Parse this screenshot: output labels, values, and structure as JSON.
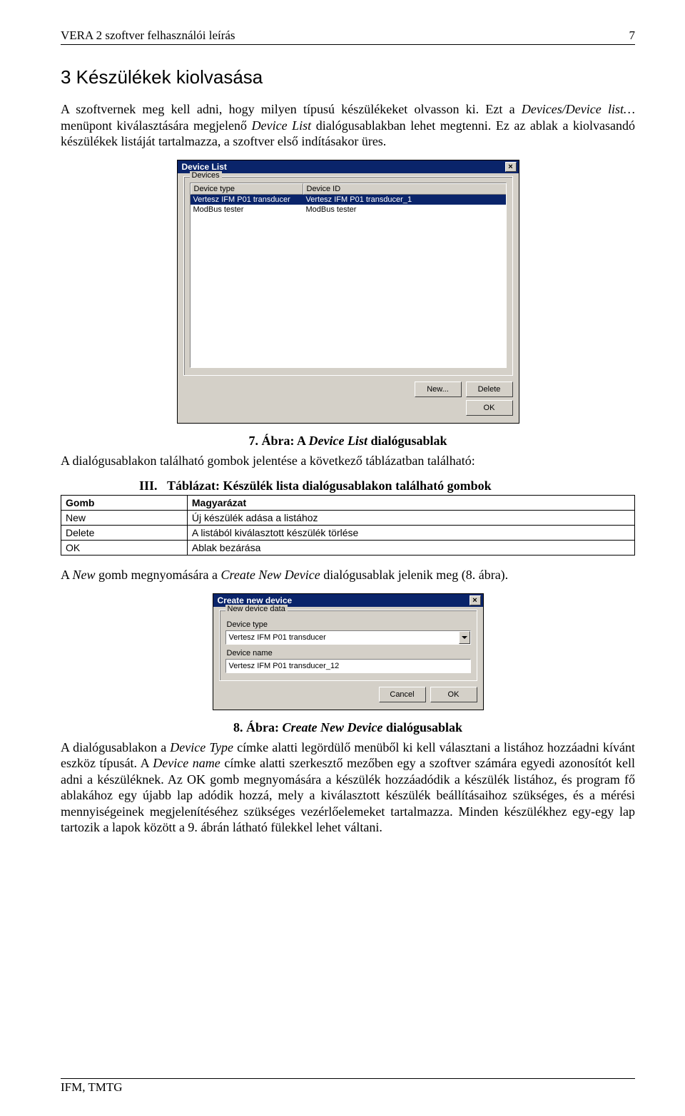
{
  "header": {
    "title": "VERA 2 szoftver felhasználói leírás",
    "page_num": "7"
  },
  "section_title": "3  Készülékek kiolvasása",
  "p1": {
    "pre": "A szoftvernek meg kell adni, hogy milyen típusú készülékeket olvasson ki. Ezt a ",
    "i1": "Devices/Device list…",
    "mid1": "menüpont kiválasztására megjelenő ",
    "i2": "Device List",
    "post": " dialógusablakban lehet megtenni. Ez az ablak a kiolvasandó készülékek listáját tartalmazza, a szoftver első indításakor üres."
  },
  "dlg1": {
    "title": "Device List",
    "group": "Devices",
    "col_w": {
      "c1": 158,
      "c2": 290
    },
    "headers": [
      "Device type",
      "Device ID"
    ],
    "rows": [
      {
        "cells": [
          "Vertesz IFM P01 transducer",
          "Vertesz IFM P01 transducer_1"
        ],
        "selected": true
      },
      {
        "cells": [
          "ModBus tester",
          "ModBus tester"
        ],
        "selected": false
      }
    ],
    "btn_new": "New...",
    "btn_delete": "Delete",
    "btn_ok": "OK"
  },
  "caption1": {
    "prefix": "7. Ábra: A ",
    "name": "Device List",
    "suffix": " dialógusablak"
  },
  "p2": "A dialógusablakon található gombok jelentése a következő táblázatban található:",
  "table3": {
    "title_num": "III.",
    "title_txt": "Táblázat: Készülék lista dialógusablakon található gombok",
    "h1": "Gomb",
    "h2": "Magyarázat",
    "rows": [
      [
        "New",
        "Új készülék adása a listához"
      ],
      [
        "Delete",
        "A listából kiválasztott készülék törlése"
      ],
      [
        "OK",
        "Ablak bezárása"
      ]
    ]
  },
  "p3": {
    "pre": "A ",
    "i1": "New",
    "mid": " gomb megnyomására a ",
    "i2": "Create New Device",
    "post": " dialógusablak jelenik meg (8. ábra)."
  },
  "dlg2": {
    "title": "Create new device",
    "group": "New device data",
    "lbl_type": "Device type",
    "val_type": "Vertesz IFM P01 transducer",
    "lbl_name": "Device name",
    "val_name": "Vertesz IFM P01 transducer_12",
    "btn_cancel": "Cancel",
    "btn_ok": "OK"
  },
  "caption2": {
    "prefix": "8. Ábra: ",
    "name": "Create New Device",
    "suffix": " dialógusablak"
  },
  "p4": {
    "t1": "A dialógusablakon a ",
    "i1": "Device Type",
    "t2": " címke alatti legördülő menüből ki kell választani a listához hozzáadni kívánt eszköz típusát. A ",
    "i2": "Device name",
    "t3": " címke alatti szerkesztő mezőben egy a szoftver számára egyedi azonosítót kell adni a készüléknek. Az OK gomb megnyomására a készülék hozzáadódik a készülék listához, és program fő ablakához egy újabb lap adódik hozzá, mely a kiválasztott készülék beállításaihoz szükséges, és a mérési mennyiségeinek megjelenítéséhez szükséges vezérlőelemeket tartalmazza. Minden készülékhez egy-egy lap tartozik a lapok között a 9. ábrán látható fülekkel lehet váltani."
  },
  "footer": "IFM, TMTG"
}
